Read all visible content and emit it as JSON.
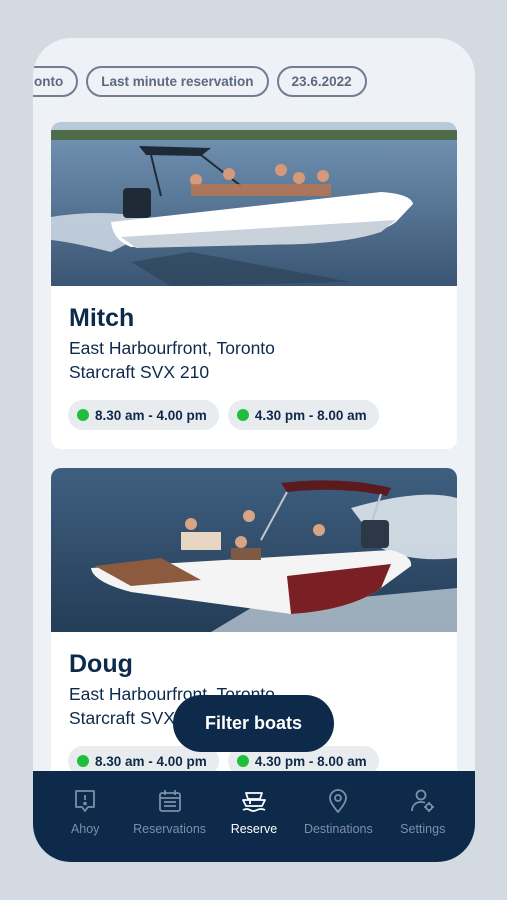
{
  "filters": {
    "chips": [
      "onto",
      "Last minute reservation",
      "23.6.2022"
    ]
  },
  "boats": [
    {
      "name": "Mitch",
      "location": "East Harbourfront, Toronto",
      "model": "Starcraft SVX 210",
      "slots": [
        "8.30 am - 4.00 pm",
        "4.30 pm - 8.00 am"
      ]
    },
    {
      "name": "Doug",
      "location": "East Harbourfront, Toronto",
      "model": "Starcraft SVX 210",
      "slots": [
        "8.30 am - 4.00 pm",
        "4.30 pm - 8.00 am"
      ]
    }
  ],
  "filter_button": "Filter boats",
  "tabbar": {
    "items": [
      {
        "label": "Ahoy",
        "icon": "ahoy-icon"
      },
      {
        "label": "Reservations",
        "icon": "calendar-icon"
      },
      {
        "label": "Reserve",
        "icon": "boat-icon"
      },
      {
        "label": "Destinations",
        "icon": "location-pin-icon"
      },
      {
        "label": "Settings",
        "icon": "user-settings-icon"
      }
    ],
    "active": "Reserve"
  },
  "colors": {
    "navy": "#0d2a4b",
    "available": "#1fbf3c",
    "background": "#eef1f5",
    "inactive_tab": "#7c8fa8"
  }
}
